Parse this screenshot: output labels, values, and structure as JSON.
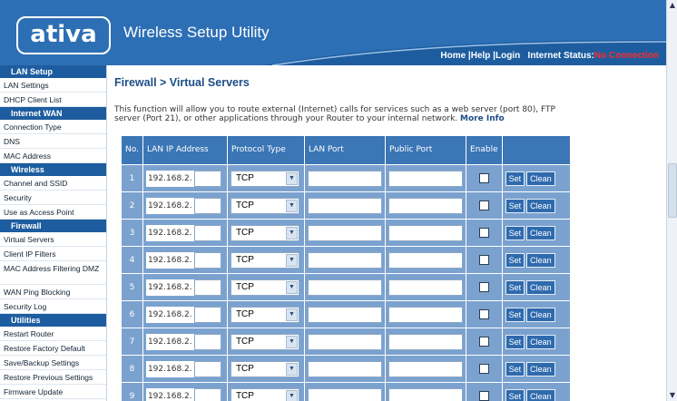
{
  "header": {
    "logo": "ativa",
    "app_title": "Wireless Setup Utility",
    "nav": {
      "home": "Home",
      "help": "Help",
      "login": "Login",
      "status_label": "Internet Status:",
      "status_value": "No Connection"
    }
  },
  "sidebar": {
    "sections": [
      {
        "title": "LAN Setup",
        "items": [
          "LAN Settings",
          "DHCP Client List"
        ]
      },
      {
        "title": "Internet WAN",
        "items": [
          "Connection Type",
          "DNS",
          "MAC Address"
        ]
      },
      {
        "title": "Wireless",
        "items": [
          "Channel and SSID",
          "Security",
          "Use as Access Point"
        ]
      },
      {
        "title": "Firewall",
        "items": [
          "Virtual Servers",
          "Client IP Filters",
          "MAC Address Filtering DMZ",
          "WAN Ping Blocking",
          "Security Log"
        ]
      },
      {
        "title": "Utilities",
        "items": [
          "Restart Router",
          "Restore Factory Default",
          "Save/Backup Settings",
          "Restore Previous Settings",
          "Firmware Update"
        ]
      }
    ]
  },
  "main": {
    "title": "Firewall > Virtual Servers",
    "description": "This function will allow you to route external (Internet) calls for services such as a web server (port 80), FTP server (Port 21), or other applications through your Router to your internal network.",
    "more_info": "More Info",
    "table": {
      "headers": {
        "no": "No.",
        "lan_ip": "LAN IP Address",
        "protocol": "Protocol Type",
        "lan_port": "LAN Port",
        "public_port": "Public Port",
        "enable": "Enable"
      },
      "ip_prefix": "192.168.2.",
      "protocol_value": "TCP",
      "set_label": "Set",
      "clean_label": "Clean",
      "rows": [
        "1",
        "2",
        "3",
        "4",
        "5",
        "6",
        "7",
        "8",
        "9"
      ]
    }
  },
  "colors": {
    "header_blue": "#1d5d9f",
    "table_header": "#3b76b6",
    "table_cell": "#7ba2cf",
    "status_red": "#ff2a2a"
  },
  "icons": {
    "dropdown": "chevron-down-icon",
    "scroll_up": "arrow-up-icon",
    "scroll_down": "arrow-down-icon"
  }
}
